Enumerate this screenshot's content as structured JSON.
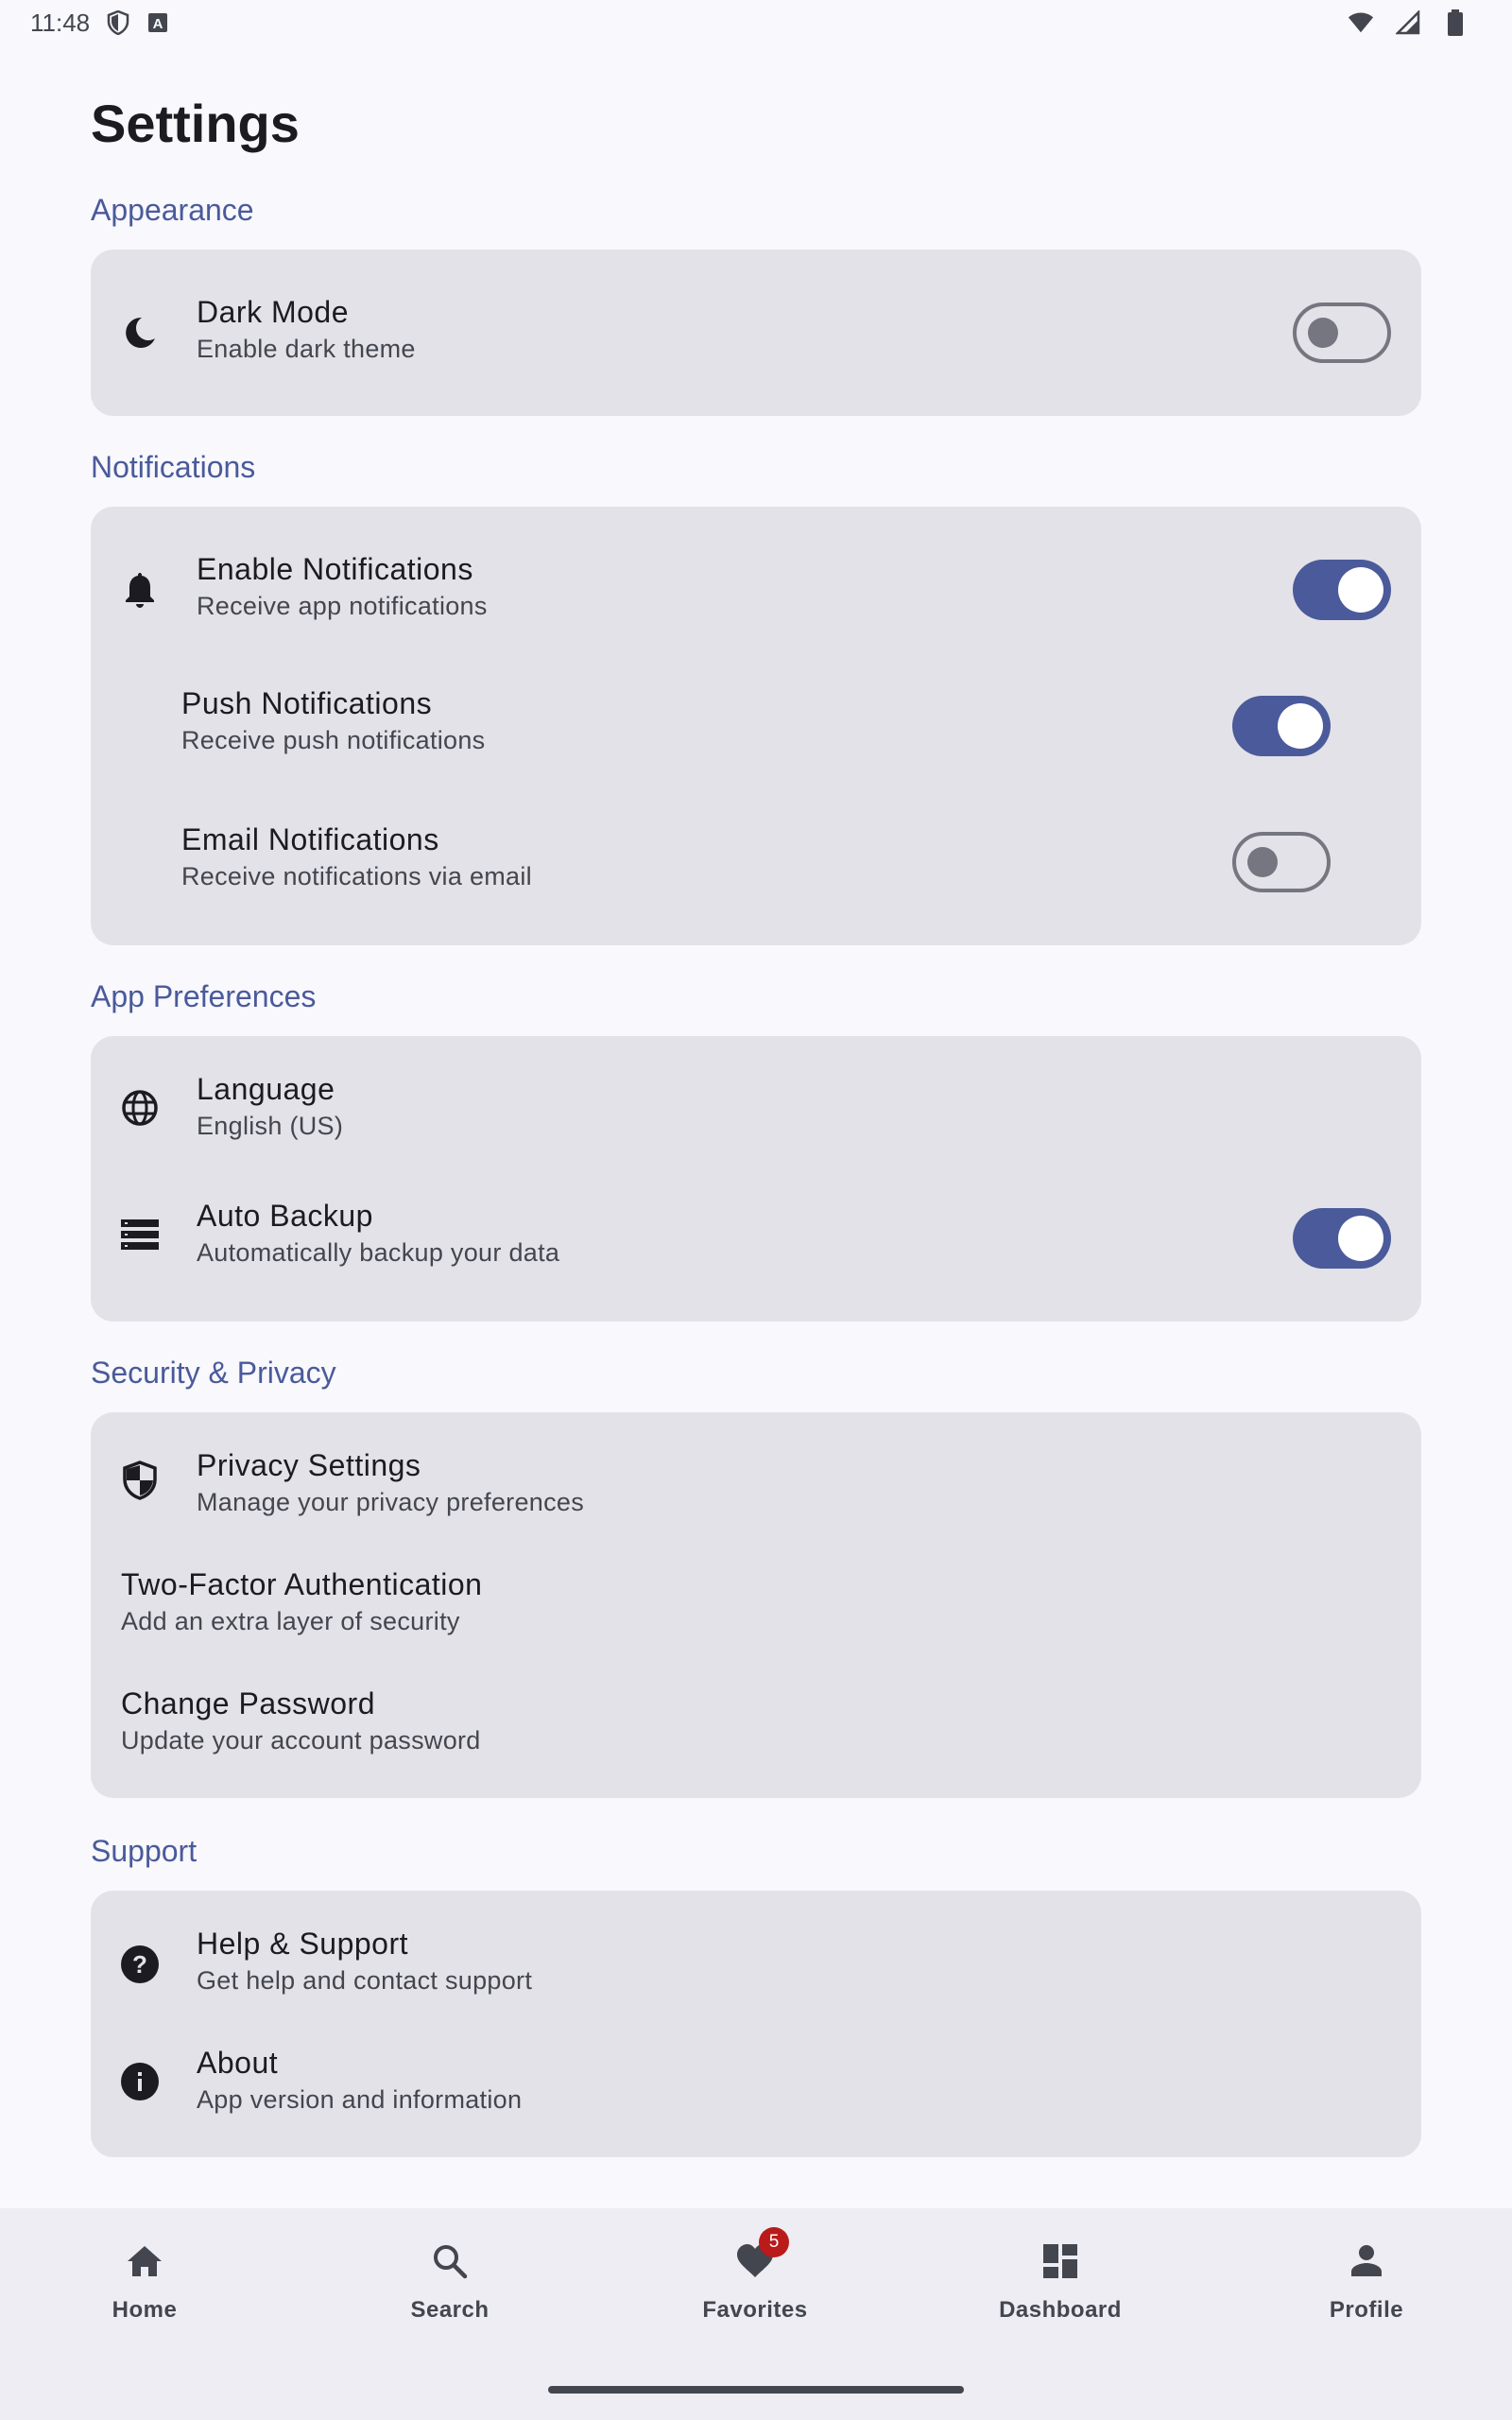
{
  "status_bar": {
    "time": "11:48",
    "icons": [
      "shield-status-icon",
      "keyboard-a-icon",
      "wifi-icon",
      "signal-icon",
      "battery-icon"
    ]
  },
  "page": {
    "title": "Settings"
  },
  "sections": {
    "appearance": {
      "title": "Appearance",
      "dark_mode": {
        "title": "Dark Mode",
        "subtitle": "Enable dark theme",
        "toggle_on": false
      }
    },
    "notifications": {
      "title": "Notifications",
      "enable": {
        "title": "Enable Notifications",
        "subtitle": "Receive app notifications",
        "toggle_on": true
      },
      "push": {
        "title": "Push Notifications",
        "subtitle": "Receive push notifications",
        "toggle_on": true
      },
      "email": {
        "title": "Email Notifications",
        "subtitle": "Receive notifications via email",
        "toggle_on": false
      }
    },
    "app_preferences": {
      "title": "App Preferences",
      "language": {
        "title": "Language",
        "subtitle": "English (US)"
      },
      "auto_backup": {
        "title": "Auto Backup",
        "subtitle": "Automatically backup your data",
        "toggle_on": true
      }
    },
    "security": {
      "title": "Security & Privacy",
      "privacy": {
        "title": "Privacy Settings",
        "subtitle": "Manage your privacy preferences"
      },
      "two_factor": {
        "title": "Two-Factor Authentication",
        "subtitle": "Add an extra layer of security"
      },
      "password": {
        "title": "Change Password",
        "subtitle": "Update your account password"
      }
    },
    "support": {
      "title": "Support",
      "help": {
        "title": "Help & Support",
        "subtitle": "Get help and contact support"
      },
      "about": {
        "title": "About",
        "subtitle": "App version and information"
      }
    }
  },
  "bottom_nav": {
    "items": [
      {
        "label": "Home",
        "icon": "home-icon"
      },
      {
        "label": "Search",
        "icon": "search-icon"
      },
      {
        "label": "Favorites",
        "icon": "heart-icon",
        "badge": "5"
      },
      {
        "label": "Dashboard",
        "icon": "dashboard-icon"
      },
      {
        "label": "Profile",
        "icon": "person-icon"
      }
    ]
  },
  "colors": {
    "accent": "#4a5a9a",
    "card": "#e3e2e8",
    "background": "#f8f8fd",
    "badge": "#ba1a1a"
  }
}
